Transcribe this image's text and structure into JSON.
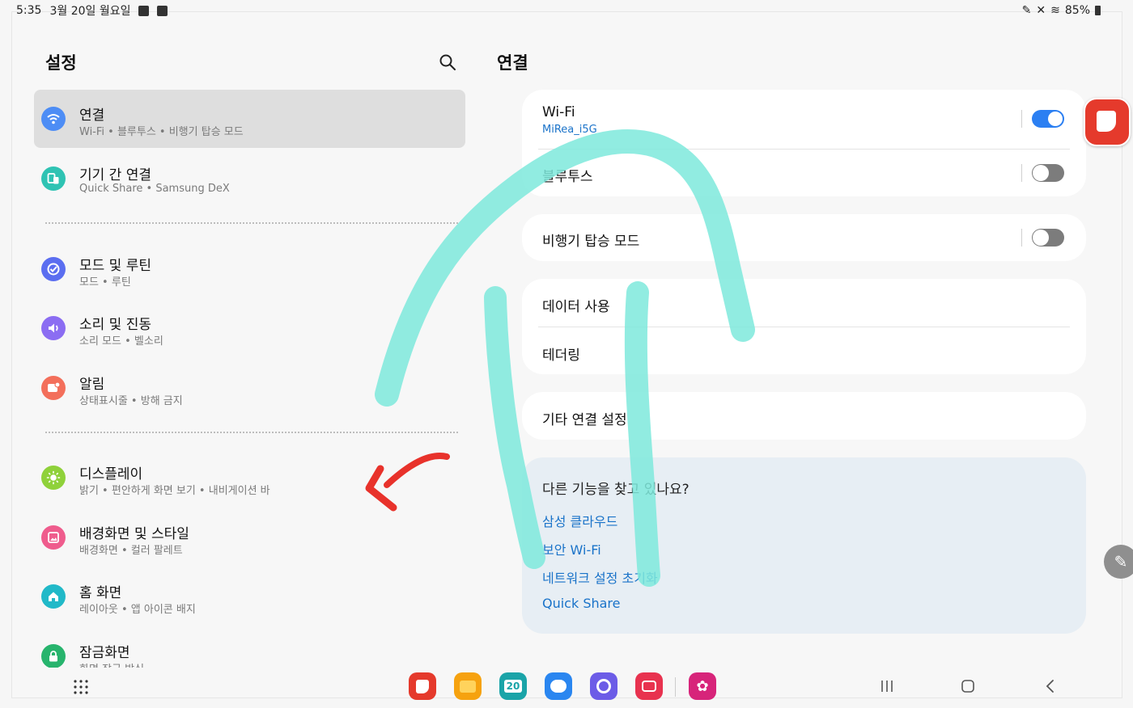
{
  "status_bar": {
    "time": "5:35",
    "date": "3월 20일 월요일",
    "battery": "85%"
  },
  "left_pane": {
    "title": "설정",
    "items": [
      {
        "title": "연결",
        "sub": "Wi-Fi  •  블루투스  •  비행기 탑승 모드",
        "color": "#4d8df5",
        "icon": "wifi-icon"
      },
      {
        "title": "기기 간 연결",
        "sub": "Quick Share  •  Samsung DeX",
        "color": "#2fc3b3",
        "icon": "devices-icon"
      },
      {
        "title": "모드 및 루틴",
        "sub": "모드  •  루틴",
        "color": "#5b6ef0",
        "icon": "routine-check-icon"
      },
      {
        "title": "소리 및 진동",
        "sub": "소리 모드  •  벨소리",
        "color": "#8b6df2",
        "icon": "speaker-icon"
      },
      {
        "title": "알림",
        "sub": "상태표시줄  •  방해 금지",
        "color": "#f36f5b",
        "icon": "notification-icon"
      },
      {
        "title": "디스플레이",
        "sub": "밝기  •  편안하게 화면 보기  •  내비게이션 바",
        "color": "#8fd13a",
        "icon": "brightness-icon"
      },
      {
        "title": "배경화면 및 스타일",
        "sub": "배경화면  •  컬러 팔레트",
        "color": "#ef5c8d",
        "icon": "wallpaper-icon"
      },
      {
        "title": "홈 화면",
        "sub": "레이아웃  •  앱 아이콘 배지",
        "color": "#21b9c8",
        "icon": "home-icon"
      },
      {
        "title": "잠금화면",
        "sub": "화면 잠금 방식",
        "color": "#27b46d",
        "icon": "lock-icon"
      }
    ]
  },
  "right_pane": {
    "title": "연결",
    "wifi": {
      "label": "Wi-Fi",
      "network": "MiRea_i5G",
      "on": true
    },
    "bluetooth": {
      "label": "블루투스",
      "on": false
    },
    "airplane": {
      "label": "비행기 탑승 모드",
      "on": false
    },
    "data_usage": "데이터 사용",
    "tethering": "테더링",
    "other": "기타 연결 설정",
    "suggest": {
      "question": "다른 기능을 찾고 있나요?",
      "links": [
        "삼성 클라우드",
        "보안 Wi-Fi",
        "네트워크 설정 초기화",
        "Quick Share"
      ]
    }
  },
  "dock": {
    "calendar_day": "20"
  },
  "colors": {
    "accent": "#1a73c9",
    "toggle_on": "#2b7ff2",
    "annotation_teal": "#7ee9dc",
    "annotation_red": "#e8322b"
  }
}
